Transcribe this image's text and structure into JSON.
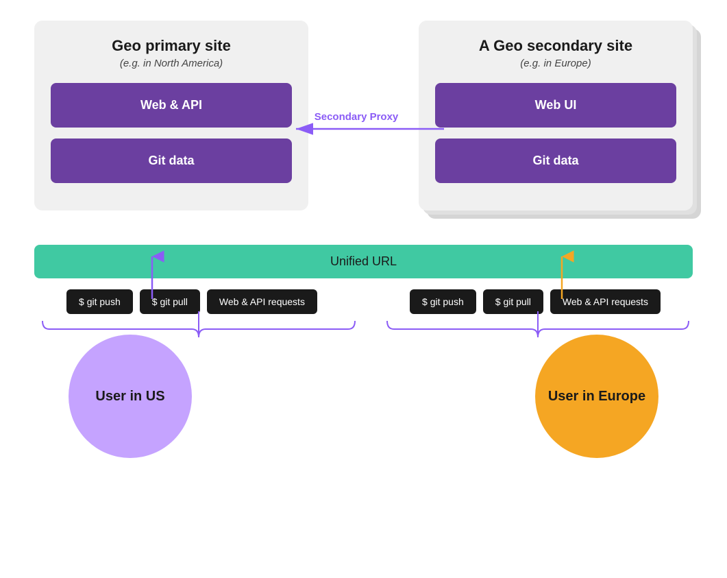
{
  "primary_site": {
    "title": "Geo primary site",
    "subtitle": "(e.g. in North America)",
    "box1_label": "Web & API",
    "box2_label": "Git data"
  },
  "secondary_site": {
    "title": "A Geo secondary site",
    "subtitle": "(e.g. in Europe)",
    "box1_label": "Web UI",
    "box2_label": "Git data"
  },
  "proxy_label": "Secondary Proxy",
  "unified_url_label": "Unified URL",
  "us_commands": [
    "$ git push",
    "$ git pull",
    "Web & API requests"
  ],
  "europe_commands": [
    "$ git push",
    "$ git pull",
    "Web & API requests"
  ],
  "user_us_label": "User in US",
  "user_europe_label": "User in Europe",
  "colors": {
    "purple_box": "#6b3fa0",
    "teal_bar": "#40c9a2",
    "user_us": "#c5a3ff",
    "user_europe": "#f5a623",
    "arrow_purple": "#8b5cf6",
    "arrow_orange": "#f5a623",
    "proxy_text": "#8b5cf6",
    "site_bg": "#f0f0f0",
    "cmd_bg": "#1a1a1a"
  }
}
